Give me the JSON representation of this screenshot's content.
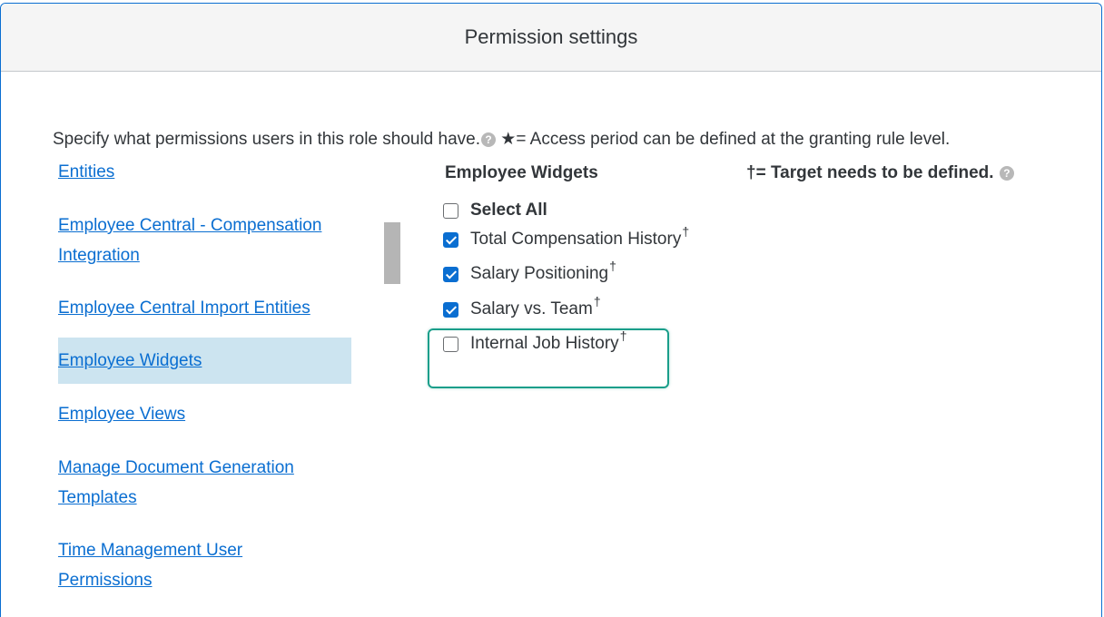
{
  "dialog": {
    "title": "Permission settings"
  },
  "intro": {
    "text": "Specify what permissions users in this role should have.",
    "help_icon": "question-circle-icon",
    "star_note": " ★= Access period can be defined at the granting rule level."
  },
  "nav": {
    "items": [
      {
        "label": "Entities",
        "selected": false
      },
      {
        "label": "Employee Central - Compensation",
        "label2": "Integration",
        "selected": false
      },
      {
        "label": "Employee Central Import Entities",
        "selected": false
      },
      {
        "label": "Employee Widgets",
        "selected": true
      },
      {
        "label": "Employee Views",
        "selected": false
      },
      {
        "label": "Manage Document Generation",
        "label2": "Templates",
        "selected": false
      },
      {
        "label": "Time Management User",
        "label2": "Permissions",
        "selected": false
      }
    ]
  },
  "section": {
    "title": "Employee Widgets",
    "legend": "†= Target needs to be defined.",
    "legend_icon": "question-circle-icon"
  },
  "permissions": [
    {
      "label": "Select All",
      "checked": false,
      "bold": true,
      "dagger": ""
    },
    {
      "label": "Total Compensation History",
      "checked": true,
      "bold": false,
      "dagger": "†"
    },
    {
      "label": "Salary Positioning",
      "checked": true,
      "bold": false,
      "dagger": "†"
    },
    {
      "label": "Salary vs. Team",
      "checked": true,
      "bold": false,
      "dagger": "†"
    },
    {
      "label": "Internal Job History",
      "checked": false,
      "bold": false,
      "dagger": "†"
    }
  ],
  "colors": {
    "link": "#0a6ed1",
    "selected_bg": "#cce4f0",
    "checkbox_checked": "#0a6ed1",
    "highlight": "#1a9e8a"
  }
}
